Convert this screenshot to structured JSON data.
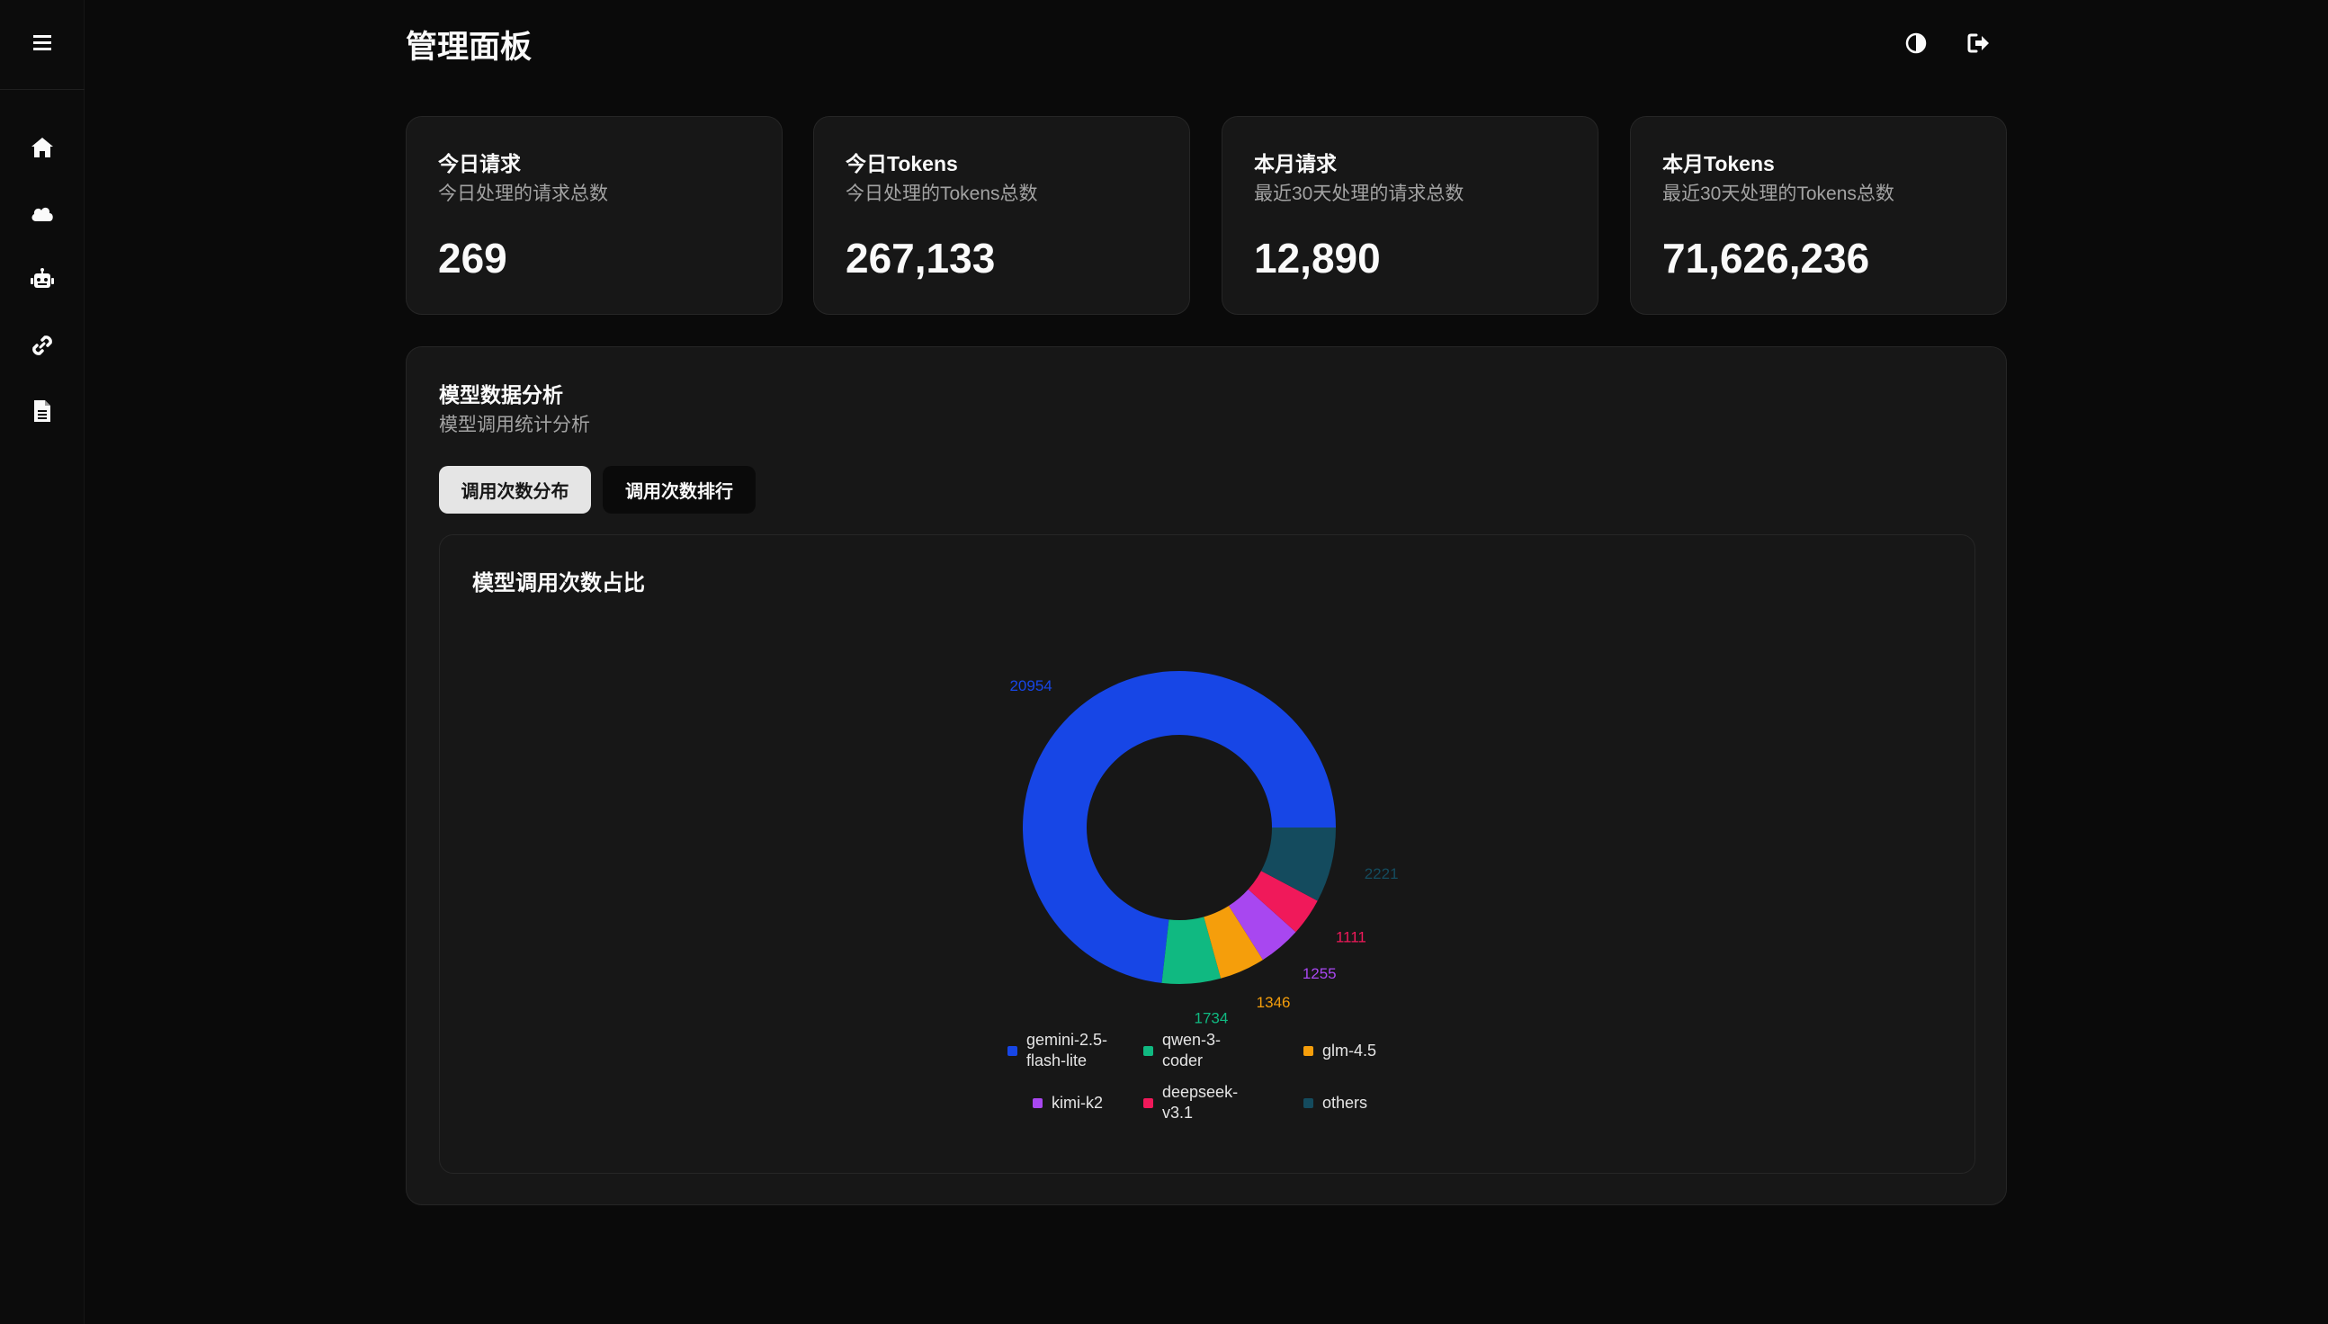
{
  "header": {
    "title": "管理面板"
  },
  "sidebar": {
    "items": [
      {
        "icon": "home-icon"
      },
      {
        "icon": "cloud-icon"
      },
      {
        "icon": "robot-icon"
      },
      {
        "icon": "link-icon"
      },
      {
        "icon": "file-text-icon"
      }
    ]
  },
  "stats": [
    {
      "title": "今日请求",
      "subtitle": "今日处理的请求总数",
      "value": "269"
    },
    {
      "title": "今日Tokens",
      "subtitle": "今日处理的Tokens总数",
      "value": "267,133"
    },
    {
      "title": "本月请求",
      "subtitle": "最近30天处理的请求总数",
      "value": "12,890"
    },
    {
      "title": "本月Tokens",
      "subtitle": "最近30天处理的Tokens总数",
      "value": "71,626,236"
    }
  ],
  "analysis": {
    "title": "模型数据分析",
    "subtitle": "模型调用统计分析",
    "tabs": [
      {
        "label": "调用次数分布",
        "active": true
      },
      {
        "label": "调用次数排行",
        "active": false
      }
    ],
    "chart_title": "模型调用次数占比"
  },
  "colors": {
    "background": "#0a0a0a",
    "card": "#171717",
    "border": "#262626",
    "text_muted": "#a3a3a3"
  },
  "chart_data": {
    "type": "pie",
    "donut": true,
    "title": "模型调用次数占比",
    "legend_position": "bottom",
    "slices": [
      {
        "name": "gemini-2.5-flash-lite",
        "legend_lines": [
          "gemini-2.5-",
          "flash-lite"
        ],
        "value": 20954,
        "color": "#1746e6"
      },
      {
        "name": "qwen-3-coder",
        "legend_lines": [
          "qwen-3-",
          "coder"
        ],
        "value": 1734,
        "color": "#10b981"
      },
      {
        "name": "glm-4.5",
        "legend_lines": [
          "glm-4.5"
        ],
        "value": 1346,
        "color": "#f59e0b"
      },
      {
        "name": "kimi-k2",
        "legend_lines": [
          "kimi-k2"
        ],
        "value": 1255,
        "color": "#a847f0"
      },
      {
        "name": "deepseek-v3.1",
        "legend_lines": [
          "deepseek-",
          "v3.1"
        ],
        "value": 1111,
        "color": "#f0195a"
      },
      {
        "name": "others",
        "legend_lines": [
          "others"
        ],
        "value": 2221,
        "color": "#144b5e"
      }
    ]
  }
}
